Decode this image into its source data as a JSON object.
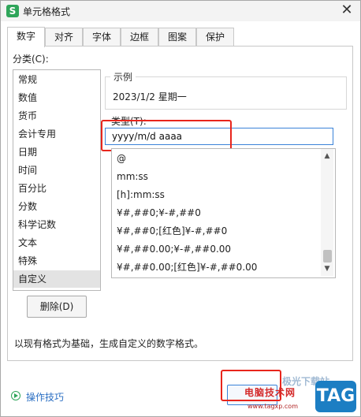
{
  "window": {
    "title": "单元格格式",
    "app_icon_letter": "S",
    "close_glyph": "✕"
  },
  "tabs": [
    {
      "label": "数字",
      "active": true
    },
    {
      "label": "对齐",
      "active": false
    },
    {
      "label": "字体",
      "active": false
    },
    {
      "label": "边框",
      "active": false
    },
    {
      "label": "图案",
      "active": false
    },
    {
      "label": "保护",
      "active": false
    }
  ],
  "category": {
    "label": "分类(C):",
    "items": [
      "常规",
      "数值",
      "货币",
      "会计专用",
      "日期",
      "时间",
      "百分比",
      "分数",
      "科学记数",
      "文本",
      "特殊",
      "自定义"
    ],
    "selected": "自定义"
  },
  "sample": {
    "label": "示例",
    "value": "2023/1/2 星期一"
  },
  "type": {
    "label": "类型(T):",
    "value": "yyyy/m/d aaaa"
  },
  "format_list": [
    "@",
    "mm:ss",
    "[h]:mm:ss",
    "¥#,##0;¥-#,##0",
    "¥#,##0;[红色]¥-#,##0",
    "¥#,##0.00;¥-#,##0.00",
    "¥#,##0.00;[红色]¥-#,##0.00"
  ],
  "buttons": {
    "delete": "删除(D)"
  },
  "description": "以现有格式为基础，生成自定义的数字格式。",
  "footer": {
    "tips_link": "操作技巧"
  },
  "watermark": {
    "top": "极光下载站",
    "cn": "电脑技术网",
    "url": "www.tagxp.com",
    "logo": "TAG"
  },
  "colors": {
    "highlight": "#e8251c",
    "accent": "#3a82d8",
    "link": "#2b6fc3",
    "app_icon": "#2fa55a"
  }
}
